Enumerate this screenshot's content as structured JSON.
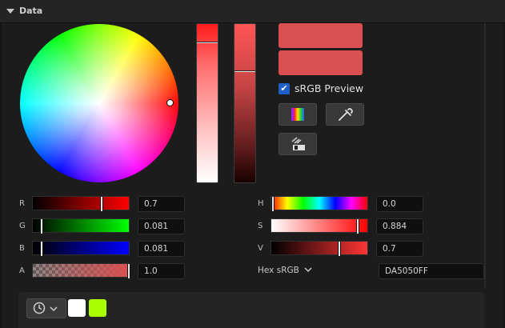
{
  "header": {
    "title": "Data"
  },
  "preview": {
    "new_color": "#da5050",
    "old_color": "#da5050",
    "srgb_preview_label": "sRGB Preview",
    "srgb_preview_checked": true
  },
  "tools": {
    "color_spectrum_button": "spectrum-icon",
    "eyedropper_button": "eyedropper-icon",
    "theme_button": "themes-icon"
  },
  "rgba": {
    "r": {
      "label": "R",
      "value": "0.7",
      "level": 0.7
    },
    "g": {
      "label": "G",
      "value": "0.081",
      "level": 0.081
    },
    "b": {
      "label": "B",
      "value": "0.081",
      "level": 0.081
    },
    "a": {
      "label": "A",
      "value": "1.0",
      "level": 1.0
    }
  },
  "hsv": {
    "h": {
      "label": "H",
      "value": "0.0",
      "level": 0.0
    },
    "s": {
      "label": "S",
      "value": "0.884",
      "level": 0.884
    },
    "v": {
      "label": "V",
      "value": "0.7",
      "level": 0.7
    }
  },
  "hex": {
    "mode_label": "Hex sRGB",
    "value": "DA5050FF"
  },
  "recent_colors": [
    "#ffffff",
    "#aaff00"
  ],
  "icons": {
    "history": "clock-icon",
    "dropdown": "chevron-down-icon"
  }
}
